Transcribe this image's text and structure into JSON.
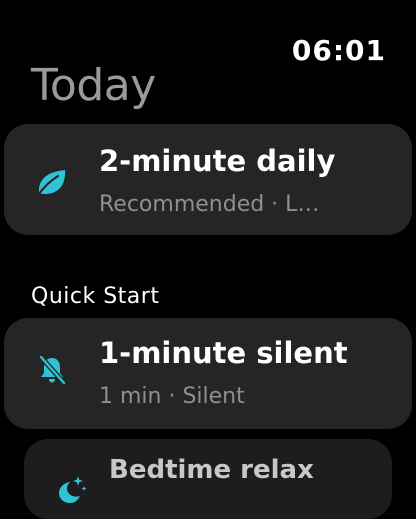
{
  "status": {
    "time": "06:01"
  },
  "page": {
    "title": "Today"
  },
  "today": {
    "card": {
      "icon": "leaf-icon",
      "title": "2-minute daily",
      "subtitle": "Recommended · L…"
    }
  },
  "quick_start": {
    "header": "Quick Start",
    "items": [
      {
        "icon": "bell-slash-icon",
        "title": "1-minute silent",
        "subtitle": "1 min · Silent"
      },
      {
        "icon": "moon-stars-icon",
        "title": "Bedtime relax"
      }
    ]
  },
  "colors": {
    "accent": "#2ec4d6",
    "card_bg": "#252525",
    "title_gray": "#9a9a9a",
    "subtitle_gray": "#8e8e93"
  }
}
